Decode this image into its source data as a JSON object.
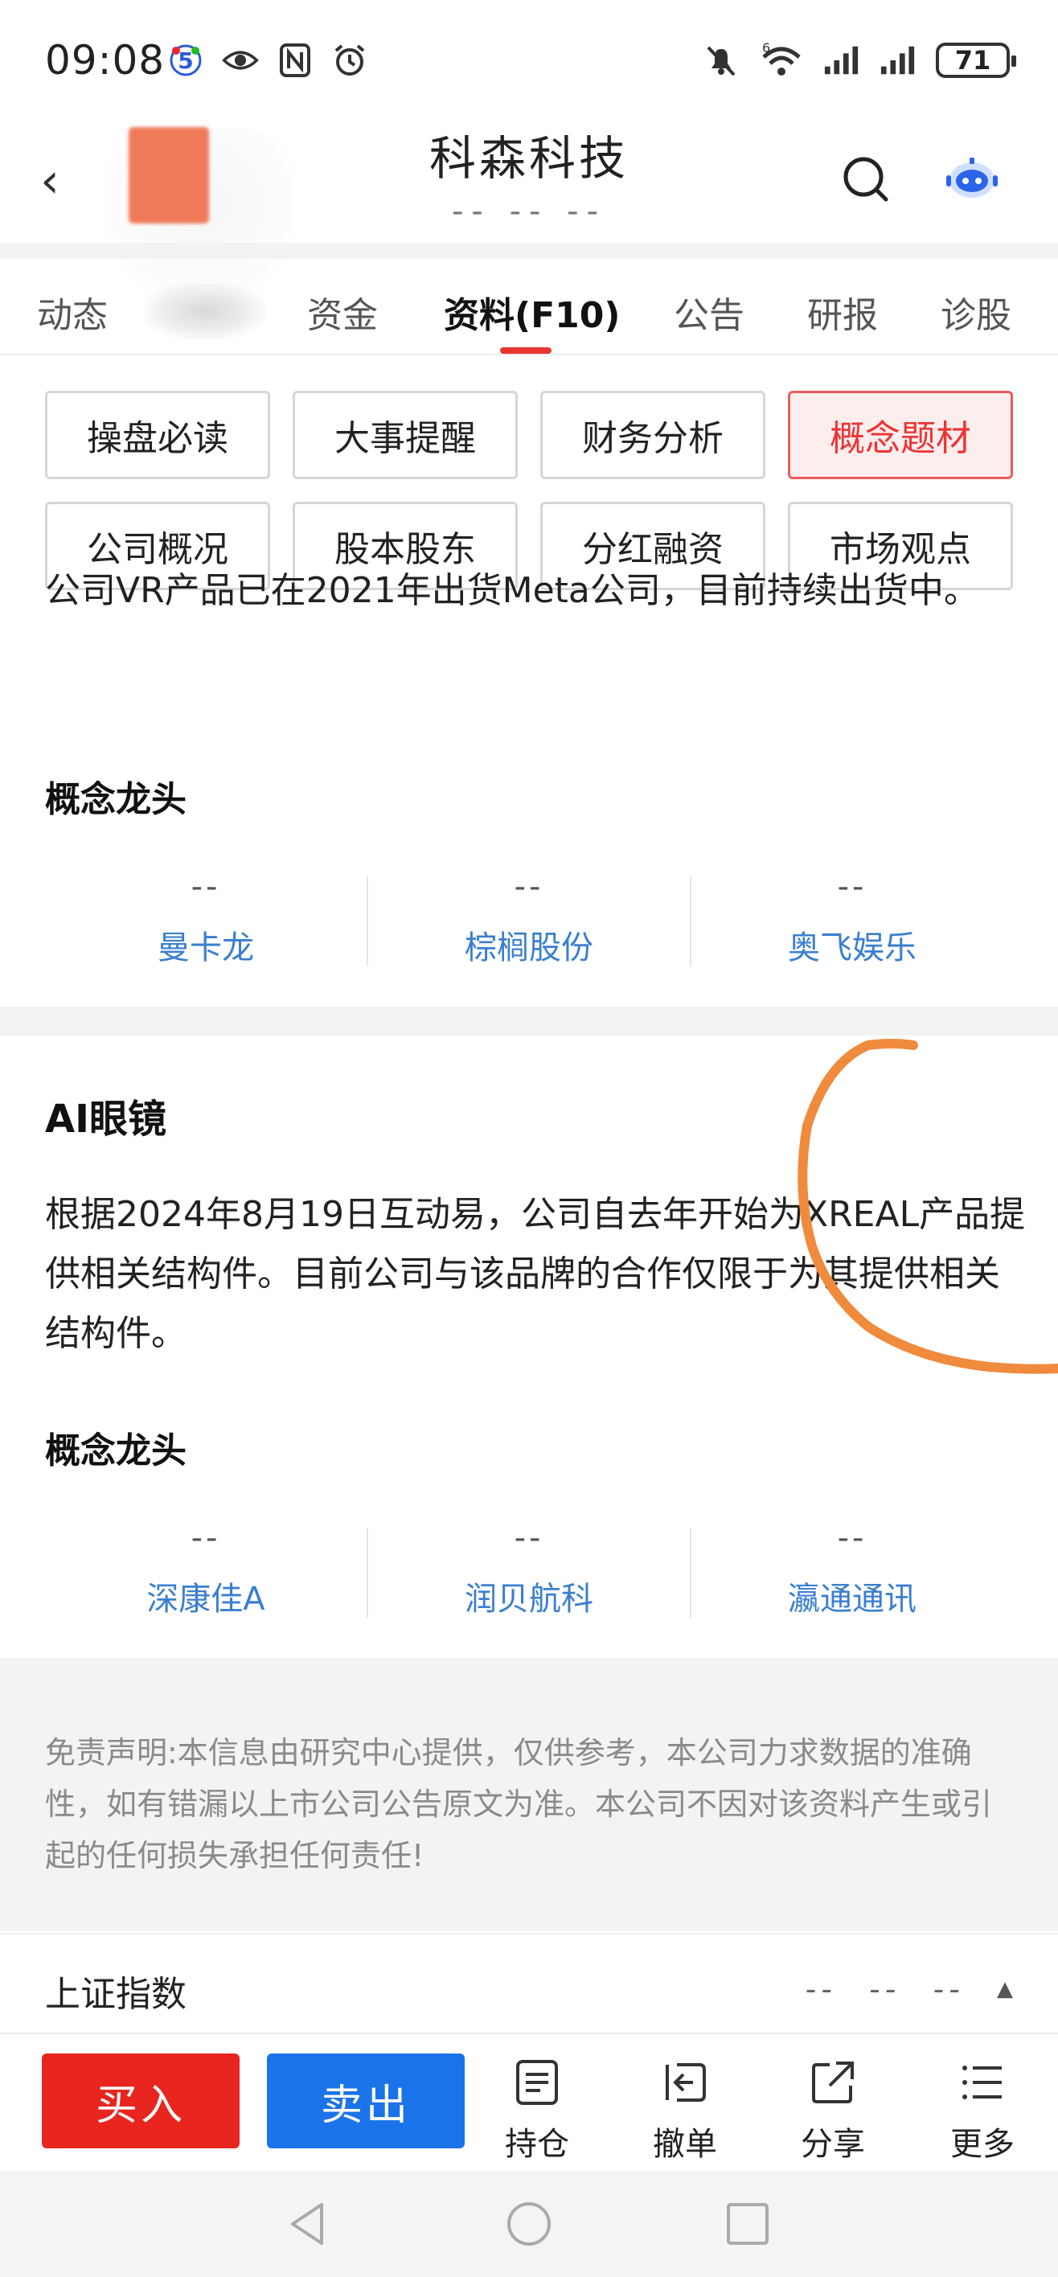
{
  "status_bar": {
    "time": "09:08",
    "battery": "71",
    "network_sup": "6"
  },
  "header": {
    "title": "科森科技",
    "subtitle": "-- -- --"
  },
  "tabs": [
    {
      "label": "动态"
    },
    {
      "label": ""
    },
    {
      "label": "资金"
    },
    {
      "label": "资料(F10)"
    },
    {
      "label": "公告"
    },
    {
      "label": "研报"
    },
    {
      "label": "诊股"
    }
  ],
  "sub_buttons": [
    {
      "label": "操盘必读"
    },
    {
      "label": "大事提醒"
    },
    {
      "label": "财务分析"
    },
    {
      "label": "概念题材"
    },
    {
      "label": "公司概况"
    },
    {
      "label": "股本股东"
    },
    {
      "label": "分红融资"
    },
    {
      "label": "市场观点"
    }
  ],
  "section_vr": {
    "clipped_text": "公司VR产品已在2021年出货Meta公司，目前持续出货中。",
    "leaders_title": "概念龙头",
    "leaders": [
      {
        "value": "--",
        "name": "曼卡龙"
      },
      {
        "value": "--",
        "name": "棕榈股份"
      },
      {
        "value": "--",
        "name": "奥飞娱乐"
      }
    ]
  },
  "section_ai": {
    "title": "AI眼镜",
    "body": "根据2024年8月19日互动易，公司自去年开始为XREAL产品提供相关结构件。目前公司与该品牌的合作仅限于为其提供相关结构件。",
    "leaders_title": "概念龙头",
    "leaders": [
      {
        "value": "--",
        "name": "深康佳A"
      },
      {
        "value": "--",
        "name": "润贝航科"
      },
      {
        "value": "--",
        "name": "瀛通通讯"
      }
    ]
  },
  "disclaimer": "免责声明:本信息由研究中心提供，仅供参考，本公司力求数据的准确性，如有错漏以上市公司公告原文为准。本公司不因对该资料产生或引起的任何损失承担任何责任!",
  "index_bar": {
    "name": "上证指数",
    "values": [
      "--",
      "--",
      "--"
    ]
  },
  "bottom_bar": {
    "buy": "买入",
    "sell": "卖出",
    "actions": [
      {
        "label": "持仓",
        "icon": "holdings-icon"
      },
      {
        "label": "撤单",
        "icon": "cancel-order-icon"
      },
      {
        "label": "分享",
        "icon": "share-icon"
      },
      {
        "label": "更多",
        "icon": "more-icon"
      }
    ]
  },
  "colors": {
    "accent_red": "#e8251f",
    "accent_blue": "#1a73e8",
    "link_blue": "#3a7fd0",
    "annotation_orange": "#f08a3c"
  }
}
